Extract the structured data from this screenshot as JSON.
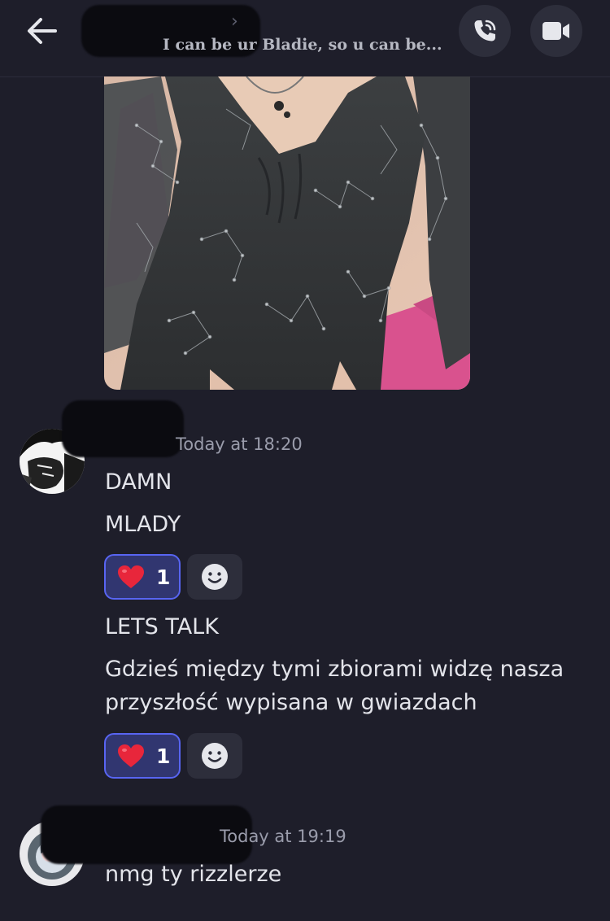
{
  "header": {
    "status_text": "I can be ur Bladie, so u can be...",
    "chevron": "›",
    "back_icon": "arrow-left-icon",
    "call_icon": "phone-call-icon",
    "video_icon": "video-camera-icon"
  },
  "messages": [
    {
      "timestamp": "Today at 18:20",
      "lines": [
        "DAMN",
        "MLADY",
        "LETS TALK",
        "Gdzieś między tymi zbiorami widzę nasza przyszłość wypisana w gwiazdach"
      ],
      "reactions": [
        {
          "emoji": "❤️",
          "count": "1"
        },
        {
          "emoji": "❤️",
          "count": "1"
        }
      ]
    },
    {
      "timestamp": "Today at 19:19",
      "lines": [
        "nmg ty rizzlerze"
      ]
    }
  ],
  "colors": {
    "background": "#1e1e2a",
    "reaction_border": "#5865f2",
    "reaction_bg": "#313670",
    "button_bg": "#2d2e3b"
  }
}
